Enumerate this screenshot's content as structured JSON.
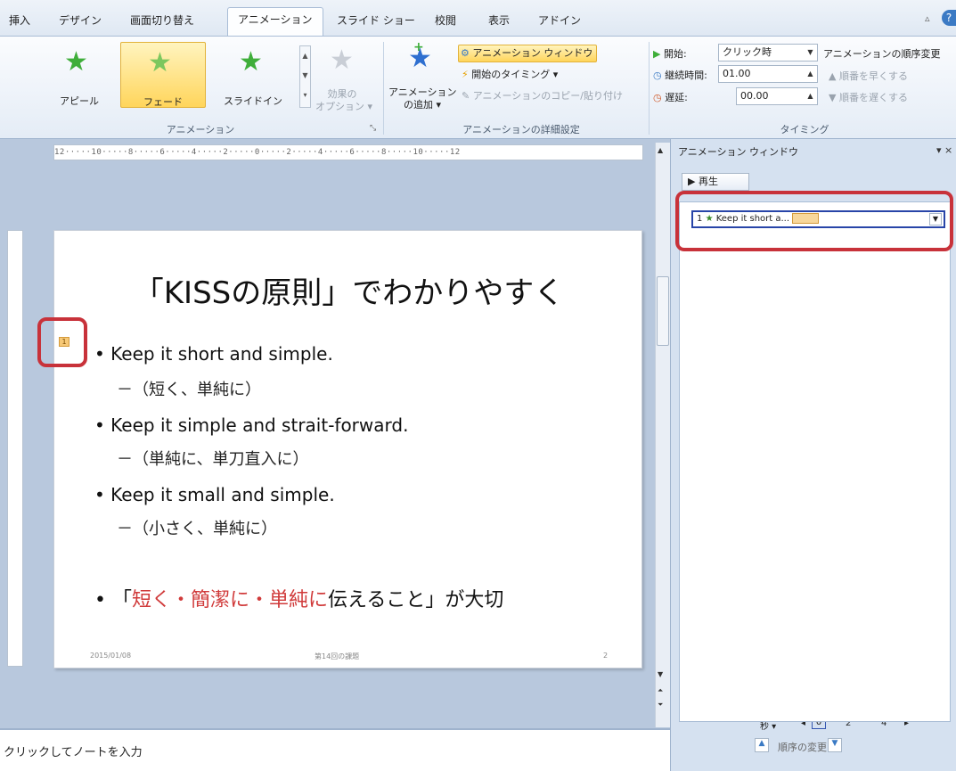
{
  "tabs": [
    "挿入",
    "デザイン",
    "画面切り替え",
    "アニメーション",
    "スライド ショー",
    "校閲",
    "表示",
    "アドイン"
  ],
  "ribbon": {
    "effects": [
      {
        "label": "アピール",
        "selected": false,
        "color": "#3fae3a"
      },
      {
        "label": "フェード",
        "selected": true,
        "color": "#5fb84a"
      },
      {
        "label": "スライドイン",
        "selected": false,
        "color": "#3fae3a"
      }
    ],
    "effect_options": {
      "line1": "効果の",
      "line2": "オプション ▾"
    },
    "group_animation": "アニメーション",
    "add_animation": {
      "line1": "アニメーション",
      "line2": "の追加 ▾"
    },
    "animation_pane_btn": "アニメーション ウィンドウ",
    "trigger_btn": "開始のタイミング ▾",
    "painter_btn": "アニメーションのコピー/貼り付け",
    "group_advanced": "アニメーションの詳細設定",
    "start_label": "開始:",
    "start_value": "クリック時",
    "duration_label": "継続時間:",
    "duration_value": "01.00",
    "delay_label": "遅延:",
    "delay_value": "00.00",
    "group_timing": "タイミング",
    "reorder_title": "アニメーションの順序変更",
    "move_earlier": "順番を早くする",
    "move_later": "順番を遅くする"
  },
  "ruler_text": "12·····10·····8·····6·····4·····2·····0·····2·····4·····6·····8·····10·····12",
  "slide": {
    "title": "「KISSの原則」でわかりやすく",
    "tag": "1",
    "bullets": [
      {
        "text": "Keep it short and simple.",
        "sub": "－（短く、単純に）"
      },
      {
        "text": "Keep it simple and strait-forward.",
        "sub": "－（単純に、単刀直入に）"
      },
      {
        "text": "Keep it small and simple.",
        "sub": "－（小さく、単純に）"
      }
    ],
    "last_bullet": {
      "open": "「",
      "red1": "短く・簡潔に・単純に",
      "rest": "伝えること」が大切"
    },
    "footer_date": "2015/01/08",
    "footer_center": "第14回の課題",
    "footer_page": "2"
  },
  "notes_placeholder": "クリックしてノートを入力",
  "pane": {
    "title": "アニメーション ウィンドウ",
    "play": "▶ 再生",
    "item": {
      "index": "1",
      "text": "Keep it short a..."
    },
    "seconds_label": "秒 ▾",
    "timeline": [
      "0",
      "2",
      "4"
    ],
    "reorder": "順序の変更"
  },
  "accent": "#c8323a"
}
